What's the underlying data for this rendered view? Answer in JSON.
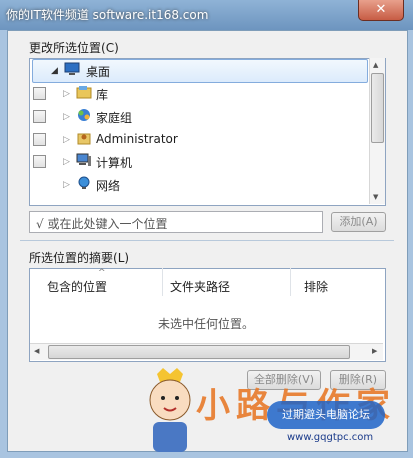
{
  "window": {
    "title": "你的IT软件频道 software.it168.com",
    "close_glyph": "✕"
  },
  "change_section": {
    "label": "更改所选位置",
    "shortcut": "(C)"
  },
  "tree": {
    "items": [
      {
        "label": "桌面",
        "icon": "desktop-icon",
        "selected": true,
        "expanded": true
      },
      {
        "label": "库",
        "icon": "library-icon"
      },
      {
        "label": "家庭组",
        "icon": "homegroup-icon"
      },
      {
        "label": "Administrator",
        "icon": "user-folder-icon"
      },
      {
        "label": "计算机",
        "icon": "computer-icon"
      },
      {
        "label": "网络",
        "icon": "network-icon"
      }
    ]
  },
  "location_input": {
    "value": "√ 或在此处键入一个位置"
  },
  "add_button": {
    "label": "添加(A)"
  },
  "summary_section": {
    "label": "所选位置的摘要",
    "shortcut": "(L)"
  },
  "summary_list": {
    "columns": [
      "包含的位置",
      "文件夹路径",
      "排除"
    ],
    "empty_text": "未选中任何位置。"
  },
  "remove_all_button": {
    "label": "全部删除(V)"
  },
  "remove_button": {
    "label": "删除(R)"
  },
  "watermark": {
    "brand_text": "小路与作家",
    "badge_text": "过期避头电脑论坛",
    "url": "www.gqgtpc.com"
  }
}
